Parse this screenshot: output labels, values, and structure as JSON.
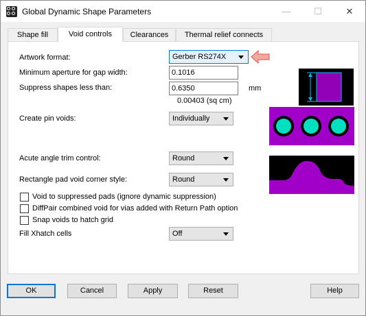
{
  "window": {
    "title": "Global Dynamic Shape Parameters",
    "minimize": "—",
    "maximize": "☐",
    "close": "✕"
  },
  "tabs": [
    {
      "label": "Shape fill"
    },
    {
      "label": "Void controls"
    },
    {
      "label": "Clearances"
    },
    {
      "label": "Thermal relief connects"
    }
  ],
  "form": {
    "artwork_format": {
      "label": "Artwork format:",
      "value": "Gerber RS274X"
    },
    "min_aperture": {
      "label": "Minimum aperture for gap width:",
      "value": "0.1016"
    },
    "suppress_shapes": {
      "label": "Suppress shapes less than:",
      "value": "0.6350",
      "unit": "mm",
      "area_note": "0.00403 (sq cm)"
    },
    "create_pin_voids": {
      "label": "Create pin voids:",
      "value": "Individually"
    },
    "acute_angle": {
      "label": "Acute angle trim control:",
      "value": "Round"
    },
    "rect_pad_corner": {
      "label": "Rectangle pad void corner style:",
      "value": "Round"
    },
    "checkboxes": [
      {
        "label": "Void to suppressed pads (ignore dynamic suppression)",
        "checked": false
      },
      {
        "label": "DiffPair combined void for vias added with Return Path option",
        "checked": false
      },
      {
        "label": "Snap voids to hatch grid",
        "checked": false
      }
    ],
    "fill_xhatch": {
      "label": "Fill Xhatch cells",
      "value": "Off"
    }
  },
  "buttons": {
    "ok": "OK",
    "cancel": "Cancel",
    "apply": "Apply",
    "reset": "Reset",
    "help": "Help"
  },
  "colors": {
    "magenta": "#a000c8",
    "cyan": "#00e0c0",
    "pointer": "#f4a9a0",
    "pointer_border": "#d9534f"
  }
}
